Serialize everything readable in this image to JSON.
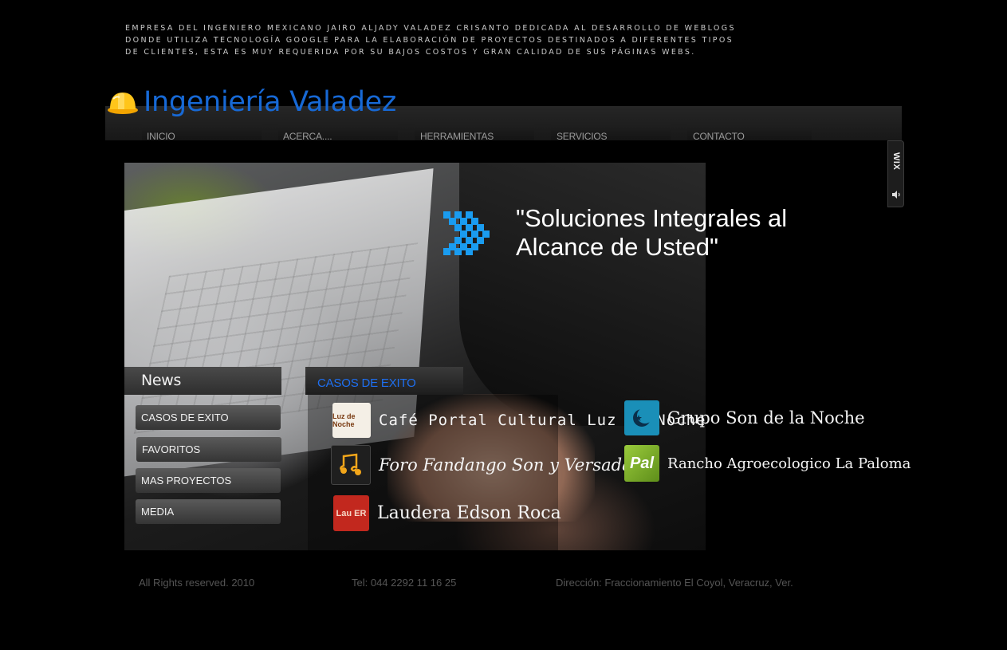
{
  "tagline": [
    "EMPRESA DEL INGENIERO MEXICANO JAIRO ALJADY VALADEZ CRISANTO DEDICADA AL DESARROLLO DE WEBLOGS",
    "DONDE UTILIZA TECNOLOGÍA GOOGLE PARA LA ELABORACIÓN DE PROYECTOS DESTINADOS A DIFERENTES TIPOS",
    "DE CLIENTES, ESTA ES MUY REQUERIDA POR SU BAJOS COSTOS Y GRAN CALIDAD DE SUS PÁGINAS WEBS."
  ],
  "logo": {
    "text": "Ingeniería Valadez",
    "icon": "hard-hat-icon",
    "color": "#1769d6"
  },
  "nav": [
    "INICIO",
    "ACERCA....",
    "HERRAMIENTAS",
    "SERVICIOS",
    "CONTACTO"
  ],
  "wix_badge": "WIX",
  "slogan": {
    "line1": "\"Soluciones Integrales al",
    "line2": "Alcance de Usted\"",
    "icon": "pixel-arrow-icon",
    "icon_color": "#1a9cf0"
  },
  "news": {
    "title": "News",
    "buttons": [
      "CASOS DE EXITO",
      "FAVORITOS",
      "MAS PROYECTOS",
      "MEDIA"
    ]
  },
  "casos": {
    "title": "CASOS DE EXITO",
    "title_color": "#1e6ff0",
    "items": [
      {
        "name": "Café Portal Cultural Luz de Noche",
        "thumb_text": "Luz de Noche"
      },
      {
        "name": "Grupo Son de la Noche",
        "thumb_text": ""
      },
      {
        "name": "Foro Fandango Son y Versada",
        "thumb_text": ""
      },
      {
        "name": "Rancho Agroecologico La Paloma",
        "thumb_text": "Pal"
      },
      {
        "name": "Laudera Edson Roca",
        "thumb_text": "Lau ER"
      }
    ]
  },
  "footer": {
    "rights": "All Rights reserved. 2010",
    "tel": "Tel: 044 2292 11 16 25",
    "address": "Dirección: Fraccionamiento El Coyol, Veracruz, Ver."
  }
}
